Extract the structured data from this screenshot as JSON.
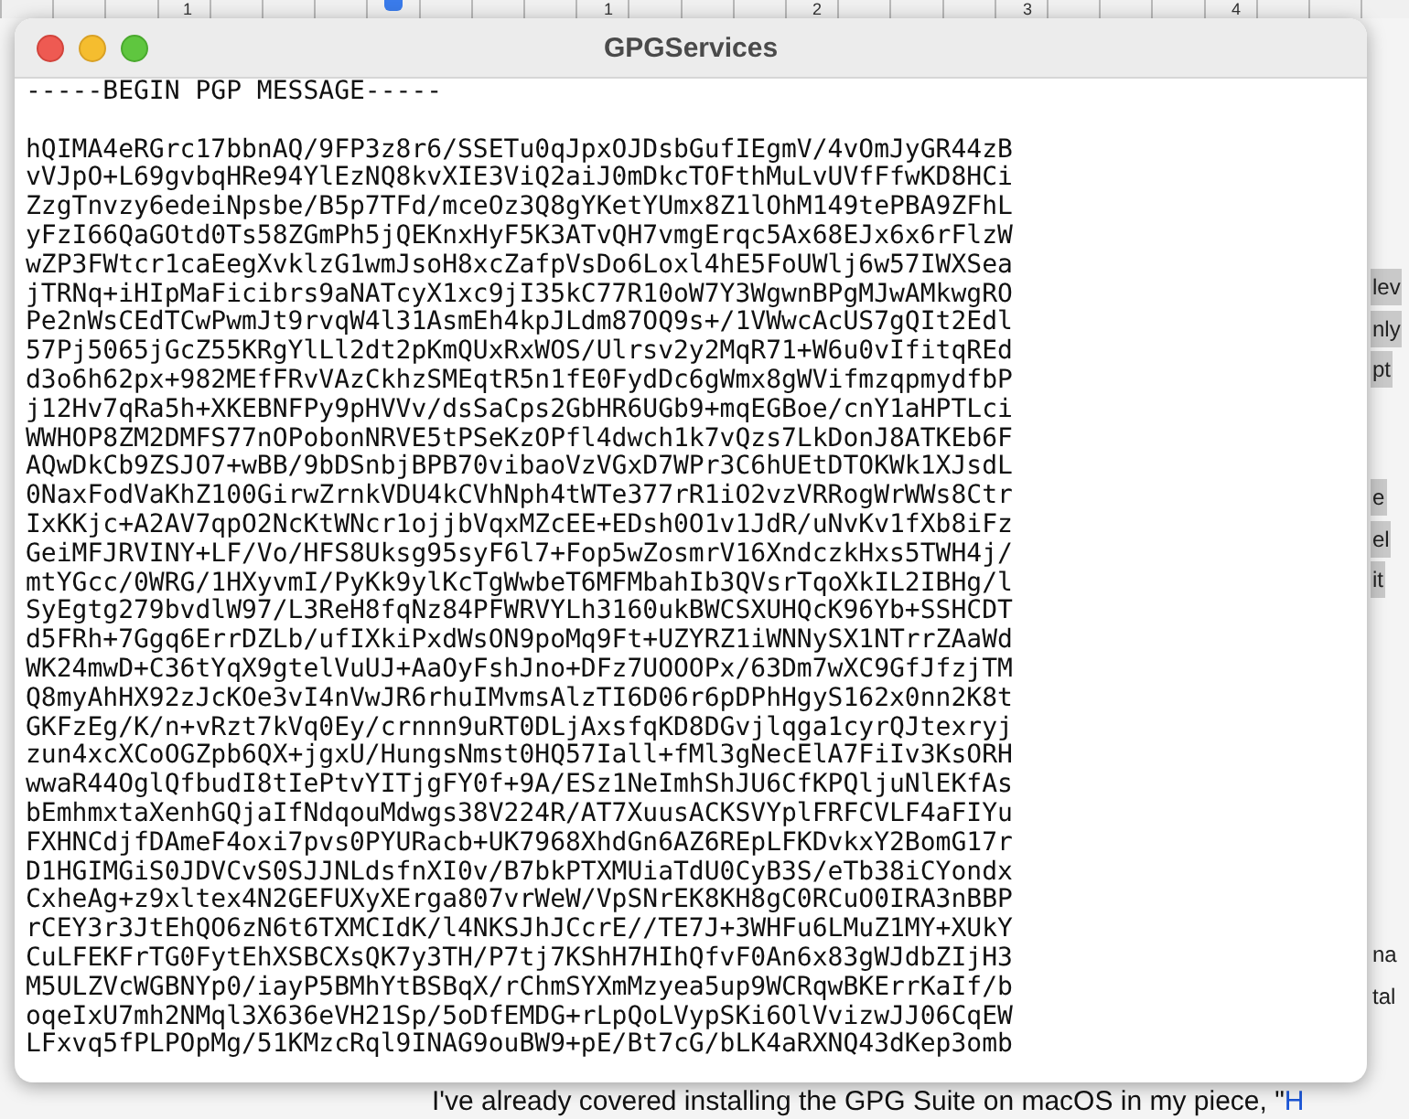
{
  "ruler": {
    "labels": [
      "1",
      "1",
      "2",
      "3",
      "4"
    ]
  },
  "window": {
    "title": "GPGServices"
  },
  "message": {
    "header": "-----BEGIN PGP MESSAGE-----",
    "lines": [
      "hQIMA4eRGrc17bbnAQ/9FP3z8r6/SSETu0qJpxOJDsbGufIEgmV/4vOmJyGR44zB",
      "vVJpO+L69gvbqHRe94YlEzNQ8kvXIE3ViQ2aiJ0mDkcTOFthMuLvUVfFfwKD8HCi",
      "ZzgTnvzy6edeiNpsbe/B5p7TFd/mceOz3Q8gYKetYUmx8Z1lOhM149tePBA9ZFhL",
      "yFzI66QaGOtd0Ts58ZGmPh5jQEKnxHyF5K3ATvQH7vmgErqc5Ax68EJx6x6rFlzW",
      "wZP3FWtcr1caEegXvklzG1wmJsoH8xcZafpVsDo6Loxl4hE5FoUWlj6w57IWXSea",
      "jTRNq+iHIpMaFicibrs9aNATcyX1xc9jI35kC77R10oW7Y3WgwnBPgMJwAMkwgRO",
      "Pe2nWsCEdTCwPwmJt9rvqW4l31AsmEh4kpJLdm87OQ9s+/1VWwcAcUS7gQIt2Edl",
      "57Pj5065jGcZ55KRgYlLl2dt2pKmQUxRxWOS/Ulrsv2y2MqR71+W6u0vIfitqREd",
      "d3o6h62px+982MEfFRvVAzCkhzSMEqtR5n1fE0FydDc6gWmx8gWVifmzqpmydfbP",
      "j12Hv7qRa5h+XKEBNFPy9pHVVv/dsSaCps2GbHR6UGb9+mqEGBoe/cnY1aHPTLci",
      "WWHOP8ZM2DMFS77nOPobonNRVE5tPSeKzOPfl4dwch1k7vQzs7LkDonJ8ATKEb6F",
      "AQwDkCb9ZSJO7+wBB/9bDSnbjBPB70vibaoVzVGxD7WPr3C6hUEtDTOKWk1XJsdL",
      "0NaxFodVaKhZ100GirwZrnkVDU4kCVhNph4tWTe377rR1iO2vzVRRogWrWWs8Ctr",
      "IxKKjc+A2AV7qpO2NcKtWNcr1ojjbVqxMZcEE+EDsh0O1v1JdR/uNvKv1fXb8iFz",
      "GeiMFJRVINY+LF/Vo/HFS8Uksg95syF6l7+Fop5wZosmrV16XndczkHxs5TWH4j/",
      "mtYGcc/0WRG/1HXyvmI/PyKk9ylKcTgWwbeT6MFMbahIb3QVsrTqoXkIL2IBHg/l",
      "SyEgtg279bvdlW97/L3ReH8fqNz84PFWRVYLh3160ukBWCSXUHQcK96Yb+SSHCDT",
      "d5FRh+7Ggq6ErrDZLb/ufIXkiPxdWsON9poMq9Ft+UZYRZ1iWNNySX1NTrrZAaWd",
      "WK24mwD+C36tYqX9gtelVuUJ+AaOyFshJno+DFz7UOOOPx/63Dm7wXC9GfJfzjTM",
      "Q8myAhHX92zJcKOe3vI4nVwJR6rhuIMvmsAlzTI6D06r6pDPhHgyS162x0nn2K8t",
      "GKFzEg/K/n+vRzt7kVq0Ey/crnnn9uRT0DLjAxsfqKD8DGvjlqga1cyrQJtexryj",
      "zun4xcXCoOGZpb6QX+jgxU/HungsNmst0HQ57Iall+fMl3gNecElA7FiIv3KsORH",
      "wwaR44OglQfbudI8tIePtvYITjgFY0f+9A/ESz1NeImhShJU6CfKPQljuNlEKfAs",
      "bEmhmxtaXenhGQjaIfNdqouMdwgs38V224R/AT7XuusACKSVYplFRFCVLF4aFIYu",
      "FXHNCdjfDAmeF4oxi7pvs0PYURacb+UK7968XhdGn6AZ6REpLFKDvkxY2BomG17r",
      "D1HGIMGiS0JDVCvS0SJJNLdsfnXI0v/B7bkPTXMUiaTdU0CyB3S/eTb38iCYondx",
      "CxheAg+z9xltex4N2GEFUXyXErga807vrWeW/VpSNrEK8KH8gC0RCuO0IRA3nBBP",
      "rCEY3r3JtEhQO6zN6t6TXMCIdK/l4NKSJhJCcrE//TE7J+3WHFu6LMuZ1MY+XUkY",
      "CuLFEKFrTG0FytEhXSBCXsQK7y3TH/P7tj7KShH7HIhQfvF0An6x83gWJdbZIjH3",
      "M5ULZVcWGBNYp0/iayP5BMhYtBSBqX/rChmSYXmMzyea5up9WCRqwBKErrKaIf/b",
      "oqeIxU7mh2NMql3X636eVH21Sp/5oDfEMDG+rLpQoLVypSKi6OlVvizwJJ06CqEW",
      "LFxvq5fPLPOpMg/51KMzcRql9INAG9ouBW9+pE/Bt7cG/bLK4aRXNQ43dKep3omb"
    ]
  },
  "background_page": {
    "fragments": [
      {
        "text": "lev",
        "highlighted": true
      },
      {
        "text": "nly",
        "highlighted": true
      },
      {
        "text": "pt",
        "highlighted": true
      },
      {
        "text": "e",
        "highlighted": true
      },
      {
        "text": "el",
        "highlighted": true
      },
      {
        "text": "it",
        "highlighted": true
      },
      {
        "text": "na",
        "highlighted": false
      },
      {
        "text": "tal",
        "highlighted": false
      }
    ],
    "bottom_text": "I've already covered installing the GPG Suite on macOS in my piece, \"",
    "bottom_link": "H"
  }
}
